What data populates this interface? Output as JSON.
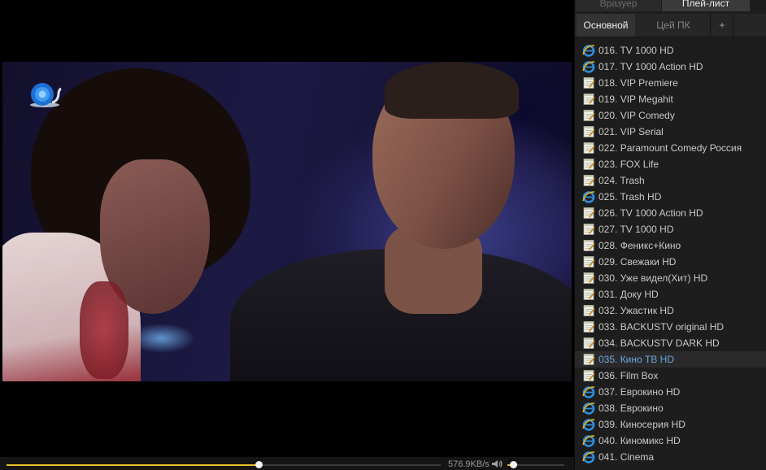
{
  "tabs": {
    "browser": "Вразуер",
    "playlist": "Плей-лист"
  },
  "sub_tabs": {
    "main": "Основной",
    "pc": "Цей ПК",
    "add": "+"
  },
  "player": {
    "speed": "576.9KB/s",
    "progress_fraction": 0.58,
    "volume_fraction": 0.1,
    "accent_color": "#e8c229",
    "logo_icon": "snail-logo-icon",
    "volume_icon": "speaker-icon"
  },
  "playlist": {
    "active_color": "#6da7e0",
    "items": [
      {
        "label": "016. TV 1000 HD",
        "icon": "ie-icon",
        "active": false
      },
      {
        "label": "017. TV 1000 Action HD",
        "icon": "ie-icon",
        "active": false
      },
      {
        "label": "018. VIP Premiere",
        "icon": "note-icon",
        "active": false
      },
      {
        "label": "019. VIP Megahit",
        "icon": "note-icon",
        "active": false
      },
      {
        "label": "020. VIP Comedy",
        "icon": "note-icon",
        "active": false
      },
      {
        "label": "021. VIP Serial",
        "icon": "note-icon",
        "active": false
      },
      {
        "label": "022. Paramount Comedy Россия",
        "icon": "note-icon",
        "active": false
      },
      {
        "label": "023. FOX Life",
        "icon": "note-icon",
        "active": false
      },
      {
        "label": "024. Trash",
        "icon": "note-icon",
        "active": false
      },
      {
        "label": "025. Trash HD",
        "icon": "ie-icon",
        "active": false
      },
      {
        "label": "026. TV 1000 Action HD",
        "icon": "note-icon",
        "active": false
      },
      {
        "label": "027. TV 1000 HD",
        "icon": "note-icon",
        "active": false
      },
      {
        "label": "028. Феникс+Кино",
        "icon": "note-icon",
        "active": false
      },
      {
        "label": "029. Свежаки HD",
        "icon": "note-icon",
        "active": false
      },
      {
        "label": "030. Уже видел(Хит) HD",
        "icon": "note-icon",
        "active": false
      },
      {
        "label": "031. Доку HD",
        "icon": "note-icon",
        "active": false
      },
      {
        "label": "032. Ужастик HD",
        "icon": "note-icon",
        "active": false
      },
      {
        "label": "033. BACKUSTV original HD",
        "icon": "note-icon",
        "active": false
      },
      {
        "label": "034. BACKUSTV DARK HD",
        "icon": "note-icon",
        "active": false
      },
      {
        "label": "035. Кино ТВ HD",
        "icon": "note-icon",
        "active": true
      },
      {
        "label": "036. Film Box",
        "icon": "note-icon",
        "active": false
      },
      {
        "label": "037. Еврокино HD",
        "icon": "ie-icon",
        "active": false
      },
      {
        "label": "038. Еврокино",
        "icon": "ie-icon",
        "active": false
      },
      {
        "label": "039. Киносерия HD",
        "icon": "ie-icon",
        "active": false
      },
      {
        "label": "040. Киномикс HD",
        "icon": "ie-icon",
        "active": false
      },
      {
        "label": "041. Cinema",
        "icon": "ie-icon",
        "active": false
      }
    ]
  }
}
